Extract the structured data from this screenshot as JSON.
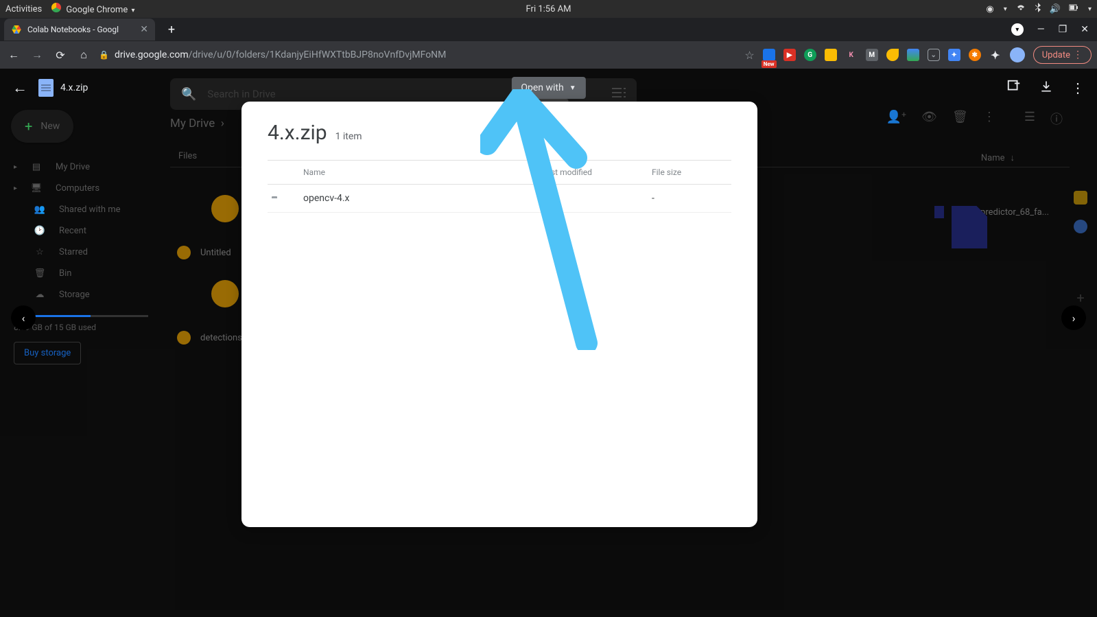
{
  "sysbar": {
    "activities": "Activities",
    "app": "Google Chrome",
    "clock": "Fri  1:56 AM"
  },
  "browser": {
    "tab_title": "Colab Notebooks - Googl",
    "url_host": "drive.google.com",
    "url_path": "/drive/u/0/folders/1KdanjyEiHfWXTtbBJP8noVnfDvjMFoNM",
    "update_label": "Update"
  },
  "drive_bg": {
    "search_placeholder": "Search in Drive",
    "new_button": "New",
    "sidebar": {
      "my_drive": "My Drive",
      "computers": "Computers",
      "shared": "Shared with me",
      "recent": "Recent",
      "starred": "Starred",
      "bin": "Bin",
      "storage": "Storage"
    },
    "storage_text": "8.59 GB of 15 GB used",
    "buy_storage": "Buy storage",
    "breadcrumb": "My Drive",
    "files_header": "Files",
    "name_header": "Name",
    "bg_files": {
      "untitled": "Untitled",
      "detections": "detections",
      "shape_predictor": "shape_predictor_68_fa..."
    }
  },
  "preview": {
    "filename": "4.x.zip",
    "open_with": "Open with",
    "tooltip": "Open wit"
  },
  "modal": {
    "title": "4.x.zip",
    "item_count": "1 item",
    "columns": {
      "name": "Name",
      "modified": "Last modified",
      "size": "File size"
    },
    "rows": [
      {
        "name": "opencv-4.x",
        "modified": "",
        "size": "-"
      }
    ]
  }
}
